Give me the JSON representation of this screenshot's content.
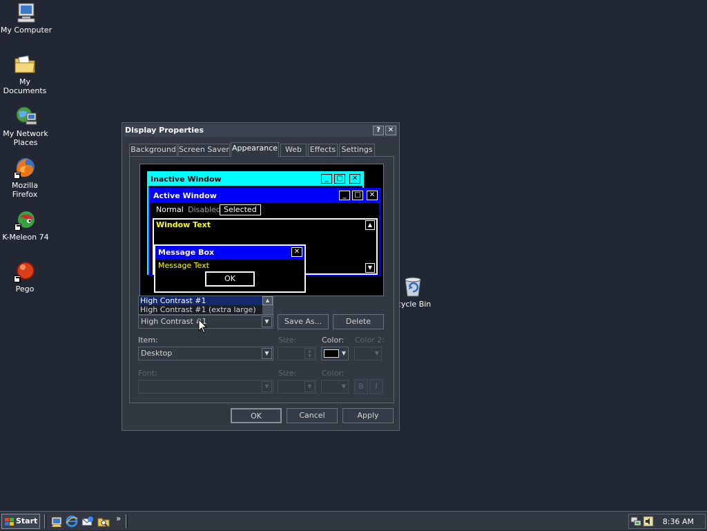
{
  "desktop": {
    "icons": [
      {
        "label": "My Computer",
        "icon": "computer-icon"
      },
      {
        "label": "My Documents",
        "icon": "folder-icon"
      },
      {
        "label": "My Network Places",
        "icon": "network-icon"
      },
      {
        "label": "Mozilla Firefox",
        "icon": "firefox-icon"
      },
      {
        "label": "K-Meleon 74",
        "icon": "k-meleon-icon"
      },
      {
        "label": "Pego",
        "icon": "pego-icon"
      },
      {
        "label": "ecycle Bin",
        "icon": "recycle-bin-icon"
      }
    ]
  },
  "dialog": {
    "title": "Display Properties",
    "help_glyph": "?",
    "close_glyph": "✕",
    "tabs": [
      "Background",
      "Screen Saver",
      "Appearance",
      "Web",
      "Effects",
      "Settings"
    ],
    "active_tab": "Appearance",
    "preview": {
      "inactive_title": "Inactive Window",
      "active_title": "Active Window",
      "menu_normal": "Normal",
      "menu_disabled": "Disabled",
      "menu_selected": "Selected",
      "window_text": "Window Text",
      "msgbox_title": "Message Box",
      "msgbox_text": "Message Text",
      "ok": "OK"
    },
    "scheme": {
      "dropdown_items": [
        "High Contrast #1",
        "High Contrast #1 (extra large)"
      ],
      "value": "High Contrast #1",
      "save_as": "Save As...",
      "delete": "Delete"
    },
    "item": {
      "label": "Item:",
      "value": "Desktop",
      "size_label": "Size:",
      "color_label": "Color:",
      "color2_label": "Color 2:",
      "color_value": "#000000"
    },
    "font": {
      "label": "Font:",
      "size_label": "Size:",
      "color_label": "Color:",
      "bold": "B",
      "italic": "I"
    },
    "buttons": {
      "ok": "OK",
      "cancel": "Cancel",
      "apply": "Apply"
    }
  },
  "taskbar": {
    "start_label": "Start",
    "chevron": "»",
    "clock": "8:36 AM"
  },
  "colors": {
    "desktop": "#222833",
    "inactive_caption": "#00ffff",
    "active_caption": "#0000ff",
    "window_text": "#ffff00"
  }
}
